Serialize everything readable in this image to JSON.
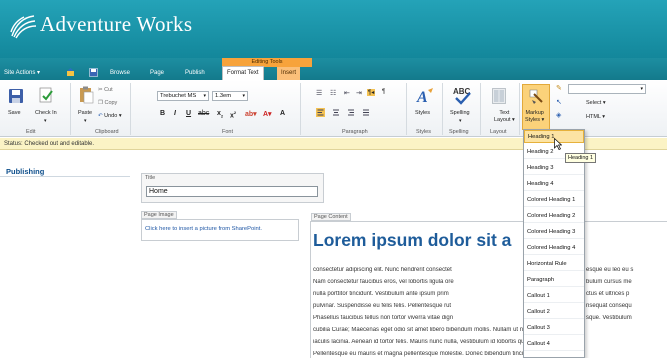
{
  "header": {
    "title": "Adventure Works"
  },
  "tabs": {
    "site_actions": "Site Actions",
    "browse": "Browse",
    "page": "Page",
    "publish": "Publish",
    "context_label": "Editing Tools",
    "format_text": "Format Text",
    "insert": "Insert"
  },
  "ribbon": {
    "edit": {
      "save": "Save",
      "check_in": "Check In",
      "label": "Edit"
    },
    "clipboard": {
      "paste": "Paste",
      "cut": "Cut",
      "copy": "Copy",
      "undo": "Undo",
      "label": "Clipboard"
    },
    "font": {
      "family": "Trebuchet MS",
      "size": "1.3em",
      "label": "Font"
    },
    "paragraph": {
      "label": "Paragraph"
    },
    "styles": {
      "styles": "Styles",
      "label": "Styles"
    },
    "spelling": {
      "spelling": "Spelling",
      "label": "Spelling"
    },
    "layout": {
      "text_layout_1": "Text",
      "text_layout_2": "Layout",
      "label": "Layout"
    },
    "markup": {
      "markup_1": "Markup",
      "markup_2": "Styles",
      "select": "Select",
      "html": "HTML"
    }
  },
  "status": {
    "text": "Status: Checked out and editable."
  },
  "leftnav": {
    "title": "Publishing"
  },
  "content": {
    "title_label": "Title",
    "title_value": "Home",
    "page_image_label": "Page Image",
    "page_image_link": "Click here to insert a picture from SharePoint.",
    "page_content_label": "Page Content",
    "heading": "Lorem ipsum dolor sit a",
    "body_lines": [
      "consectetur adipiscing elit. Nunc hendrerit consectet",
      "Nam consectetur faucibus eros, vel lobortis ligula ore",
      "nulla porttitor tincidunt. Vestibulum ante ipsum prim",
      "pulvinar. Suspendisse eu felis felis. Pellentesque rut",
      "Phasellus faucibus tellus non tortor viverra vitae dign",
      "cubilia Curae; Maecenas eget odio sit amet libero bibendum mollis. Nullam ut neque lacus",
      "iaculis lacinia. Aenean id tortor felis. Mauris nunc nulla, vestibulum id lobortis quis, adipi",
      "Pellentesque eu mauris et magna pellentesque molestie. Donec bibendum tincidunt vestib"
    ],
    "body_right": [
      "esque eu leo eu s",
      "bulum cursus me",
      "ctus et ultrices p",
      "nsequat consequ",
      "sque. Vestibulum"
    ]
  },
  "dropdown": {
    "items": [
      "Heading 1",
      "Heading 2",
      "Heading 3",
      "Heading 4",
      "Colored Heading 1",
      "Colored Heading 2",
      "Colored Heading 3",
      "Colored Heading 4",
      "Horizontal Rule",
      "Paragraph",
      "Callout 1",
      "Callout 2",
      "Callout 3",
      "Callout 4"
    ],
    "tooltip": "Heading 1"
  },
  "colors": {
    "header": "#1c8fa3",
    "context_tab": "#f7a33b",
    "heading": "#1e5c9a",
    "status_bg": "#fbf3c5"
  }
}
